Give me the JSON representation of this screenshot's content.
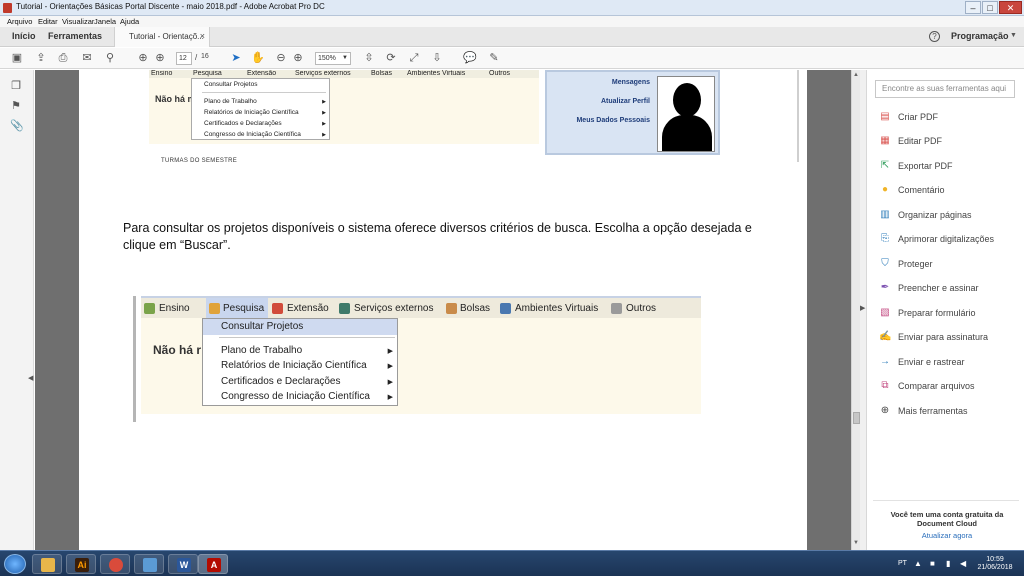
{
  "window": {
    "title": "Tutorial - Orientações Básicas Portal Discente - maio 2018.pdf - Adobe Acrobat Pro DC",
    "controls": {
      "minimize": "–",
      "maximize": "□",
      "close": "✕"
    }
  },
  "menubar": [
    "Arquivo",
    "Editar",
    "Visualizar",
    "Janela",
    "Ajuda"
  ],
  "tabbar": {
    "home": "Início",
    "tools": "Ferramentas",
    "doc_tab": "Tutorial - Orientaçõ...",
    "doc_tab_close": "×",
    "help": "?",
    "user": "Programação"
  },
  "toolbar": {
    "page_current": "12",
    "page_sep": "/",
    "page_total": "16",
    "zoom": "150%"
  },
  "document": {
    "shot1": {
      "menu": [
        "Ensino",
        "Pesquisa",
        "Extensão",
        "Serviços externos",
        "Bolsas",
        "Ambientes Virtuais",
        "Outros"
      ],
      "nao_ha": "Não há m",
      "dropdown": [
        "Consultar Projetos",
        "Plano de Trabalho",
        "Relatórios de Iniciação Científica",
        "Certificados e Declarações",
        "Congresso de Iniciação Científica"
      ],
      "turmas": "TURMAS DO SEMESTRE",
      "card_links": [
        "Mensagens",
        "Atualizar Perfil",
        "Meus Dados Pessoais"
      ]
    },
    "paragraph": "Para consultar os projetos disponíveis o sistema oferece diversos critérios de busca. Escolha a opção desejada e clique em “Buscar”.",
    "shot2": {
      "menu": [
        "Ensino",
        "Pesquisa",
        "Extensão",
        "Serviços externos",
        "Bolsas",
        "Ambientes Virtuais",
        "Outros"
      ],
      "nao_ha": "Não há r",
      "dropdown": [
        "Consultar Projetos",
        "Plano de Trabalho",
        "Relatórios de Iniciação Científica",
        "Certificados e Declarações",
        "Congresso de Iniciação Científica"
      ]
    }
  },
  "tools_panel": {
    "search_placeholder": "Encontre as suas ferramentas aqui",
    "tools": [
      {
        "label": "Criar PDF",
        "icon": "create-pdf-icon",
        "color": "#d9534f"
      },
      {
        "label": "Editar PDF",
        "icon": "edit-pdf-icon",
        "color": "#d9534f"
      },
      {
        "label": "Exportar PDF",
        "icon": "export-pdf-icon",
        "color": "#2e9d5a"
      },
      {
        "label": "Comentário",
        "icon": "comment-icon",
        "color": "#f0b429"
      },
      {
        "label": "Organizar páginas",
        "icon": "organize-pages-icon",
        "color": "#2a7ab8"
      },
      {
        "label": "Aprimorar digitalizações",
        "icon": "enhance-scans-icon",
        "color": "#2a7ab8"
      },
      {
        "label": "Proteger",
        "icon": "protect-icon",
        "color": "#2a7ab8"
      },
      {
        "label": "Preencher e assinar",
        "icon": "fill-sign-icon",
        "color": "#7b4fb0"
      },
      {
        "label": "Preparar formulário",
        "icon": "prepare-form-icon",
        "color": "#c2477f"
      },
      {
        "label": "Enviar para assinatura",
        "icon": "send-signature-icon",
        "color": "#2a5ba8"
      },
      {
        "label": "Enviar e rastrear",
        "icon": "send-track-icon",
        "color": "#2a7ab8"
      },
      {
        "label": "Comparar arquivos",
        "icon": "compare-files-icon",
        "color": "#c2477f"
      },
      {
        "label": "Mais ferramentas",
        "icon": "more-tools-icon",
        "color": "#444444"
      }
    ],
    "document_cloud_title": "Você tem uma conta gratuita da Document Cloud",
    "document_cloud_link": "Atualizar agora"
  },
  "taskbar": {
    "lang": "PT",
    "clock_time": "10:59",
    "clock_date": "21/06/2018"
  }
}
